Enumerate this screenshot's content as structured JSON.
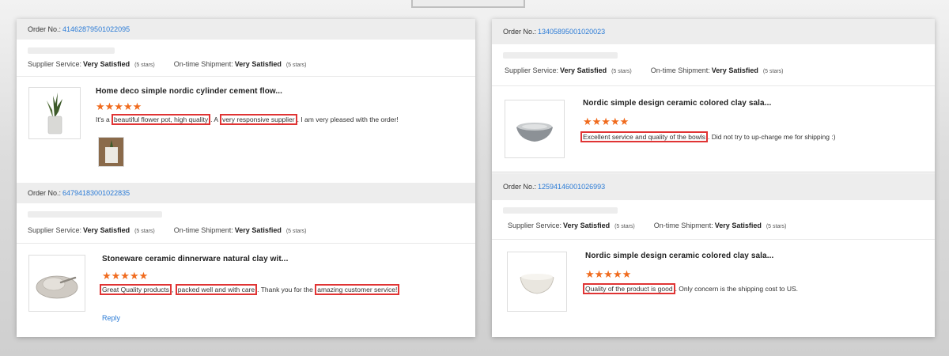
{
  "labels": {
    "order_no": "Order No.:",
    "supplier_service": "Supplier Service:",
    "ontime_shipment": "On-time Shipment:",
    "reply": "Reply"
  },
  "colors": {
    "star": "#f06b1e",
    "link": "#2b7bd6",
    "highlight": "#e03434"
  },
  "reviews": [
    {
      "order_number": "41462879501022095",
      "supplier_rating": "Very Satisfied",
      "supplier_stars": "(5 stars)",
      "shipment_rating": "Very Satisfied",
      "shipment_stars": "(5 stars)",
      "product_title": "Home deco simple nordic cylinder cement flow...",
      "stars": "★★★★★",
      "rating": 5,
      "review_segments": [
        "It's a ",
        "beautiful flower pot, high quality",
        ". A ",
        "very responsive supplier",
        ". I am very pleased with the order!"
      ],
      "product_icon": "potted-plant-icon"
    },
    {
      "order_number": "64794183001022835",
      "supplier_rating": "Very Satisfied",
      "supplier_stars": "(5 stars)",
      "shipment_rating": "Very Satisfied",
      "shipment_stars": "(5 stars)",
      "product_title": "Stoneware ceramic dinnerware natural clay wit...",
      "stars": "★★★★★",
      "rating": 5,
      "review_segments": [
        "Great Quality products",
        ", ",
        "packed well and with care",
        ". Thank you for the ",
        "amazing customer service!"
      ],
      "product_icon": "ceramic-plate-icon"
    },
    {
      "order_number": "13405895001020023",
      "supplier_rating": "Very Satisfied",
      "supplier_stars": "(5 stars)",
      "shipment_rating": "Very Satisfied",
      "shipment_stars": "(5 stars)",
      "product_title": "Nordic simple design ceramic colored clay sala...",
      "stars": "★★★★★",
      "rating": 5,
      "review_segments": [
        "Excellent service and quality of the bowls",
        ". Did not try to up-charge me for shipping :)"
      ],
      "product_icon": "grey-bowl-icon"
    },
    {
      "order_number": "12594146001026993",
      "supplier_rating": "Very Satisfied",
      "supplier_stars": "(5 stars)",
      "shipment_rating": "Very Satisfied",
      "shipment_stars": "(5 stars)",
      "product_title": "Nordic simple design ceramic colored clay sala...",
      "stars": "★★★★★",
      "rating": 5,
      "review_segments": [
        "Quality of the product is good",
        ". Only concern is the shipping cost to US."
      ],
      "product_icon": "white-bowl-icon"
    }
  ]
}
